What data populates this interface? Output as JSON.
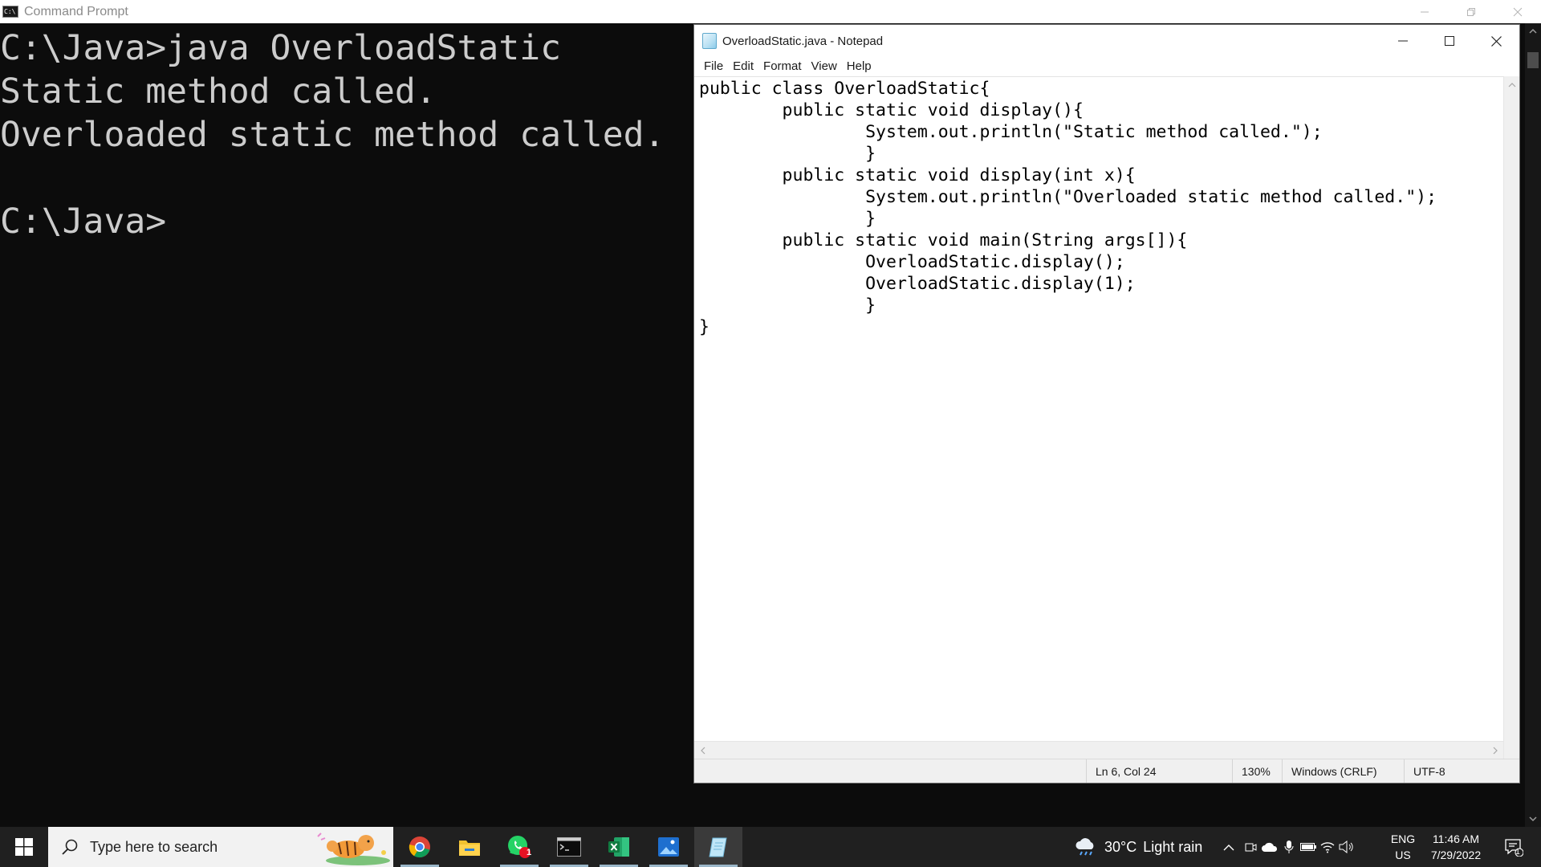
{
  "cmd": {
    "title": "Command Prompt",
    "lines": [
      "C:\\Java>java OverloadStatic",
      "Static method called.",
      "Overloaded static method called.",
      "",
      "C:\\Java>"
    ]
  },
  "notepad": {
    "title": "OverloadStatic.java - Notepad",
    "menu": [
      "File",
      "Edit",
      "Format",
      "View",
      "Help"
    ],
    "code": [
      "public class OverloadStatic{",
      "        public static void display(){",
      "                System.out.println(\"Static method called.\");",
      "                }",
      "        public static void display(int x){",
      "                System.out.println(\"Overloaded static method called.\");",
      "                }",
      "        public static void main(String args[]){",
      "                OverloadStatic.display();",
      "                OverloadStatic.display(1);",
      "                }",
      "}"
    ],
    "status": {
      "position": "Ln 6, Col 24",
      "zoom": "130%",
      "line_ending": "Windows (CRLF)",
      "encoding": "UTF-8"
    }
  },
  "taskbar": {
    "search_placeholder": "Type here to search",
    "apps": [
      "chrome-icon",
      "file-explorer-icon",
      "whatsapp-icon",
      "command-prompt-icon",
      "excel-icon",
      "photos-icon",
      "notepad-icon"
    ],
    "whatsapp_badge": "1",
    "weather": {
      "temp": "30°C",
      "condition": "Light rain"
    },
    "language": {
      "lang": "ENG",
      "region": "US"
    },
    "clock": {
      "time": "11:46 AM",
      "date": "7/29/2022"
    },
    "notification_count": "1"
  },
  "colors": {
    "console_bg": "#0c0c0c",
    "console_text": "#cccccc",
    "taskbar_bg": "#202020"
  }
}
